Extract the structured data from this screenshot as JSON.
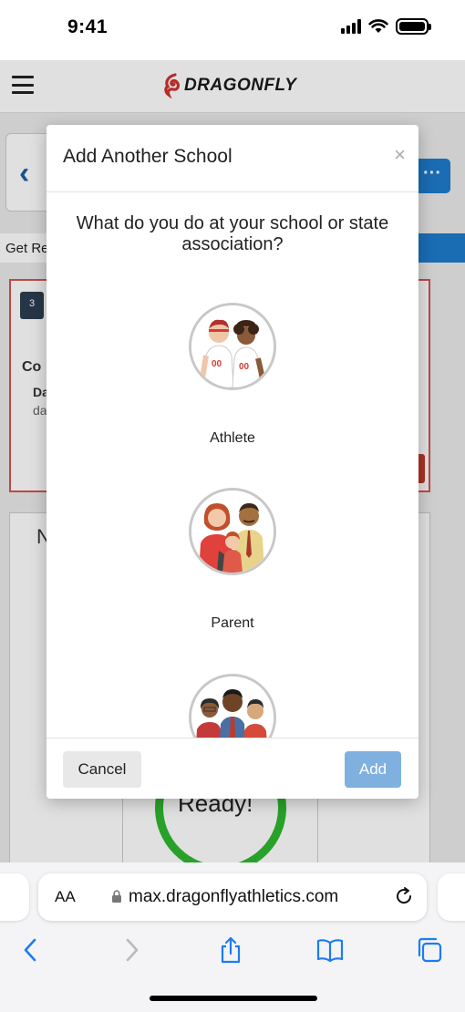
{
  "status_bar": {
    "time": "9:41"
  },
  "app": {
    "brand": "DRAGONFLY",
    "tab_label": "Get Re",
    "card_title": "Co",
    "card_sub": "Da",
    "card_sub2": "da",
    "grid_letter": "N",
    "ready_text": "Ready!"
  },
  "modal": {
    "title": "Add Another School",
    "close_label": "×",
    "question": "What do you do at your school or state association?",
    "roles": [
      {
        "label": "Athlete",
        "icon": "athlete-avatar-icon"
      },
      {
        "label": "Parent",
        "icon": "parent-avatar-icon"
      },
      {
        "label": "",
        "icon": "staff-avatar-icon"
      }
    ],
    "cancel_label": "Cancel",
    "add_label": "Add"
  },
  "browser": {
    "text_size_label": "AA",
    "url": "max.dragonflyathletics.com"
  },
  "colors": {
    "accent_blue": "#1e7ccc",
    "add_disabled": "#7fb0e0",
    "ready_green": "#2eb82e",
    "alert_red": "#d9534f"
  }
}
